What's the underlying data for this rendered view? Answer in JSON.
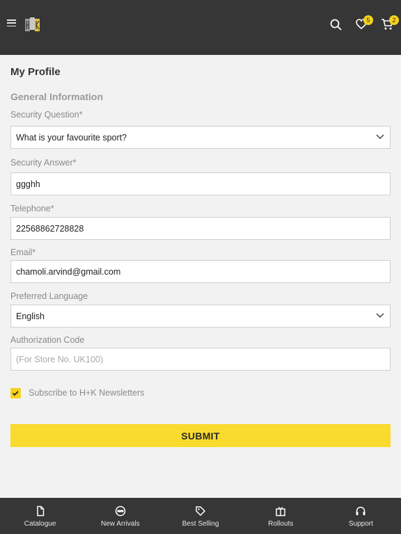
{
  "header": {
    "wishlist_count": "5",
    "cart_count": "2"
  },
  "profile": {
    "title": "My Profile",
    "section_title": "General Information",
    "security_question": {
      "label": "Security Question*",
      "value": "What is your favourite sport?"
    },
    "security_answer": {
      "label": "Security Answer*",
      "value": "ggghh"
    },
    "telephone": {
      "label": "Telephone*",
      "value": "22568862728828"
    },
    "email": {
      "label": "Email*",
      "value": "chamoli.arvind@gmail.com"
    },
    "preferred_language": {
      "label": "Preferred Language",
      "value": "English"
    },
    "authorization_code": {
      "label": "Authorization Code",
      "placeholder": "(For Store No. UK100)"
    },
    "newsletter": {
      "label": "Subscribe to H+K Newsletters",
      "checked": true
    },
    "submit_label": "SUBMIT"
  },
  "bottom_nav": {
    "items": [
      {
        "label": "Catalogue",
        "icon": "document-icon"
      },
      {
        "label": "New Arrivals",
        "icon": "new-badge-icon"
      },
      {
        "label": "Best Selling",
        "icon": "tag-icon"
      },
      {
        "label": "Rollouts",
        "icon": "box-icon"
      },
      {
        "label": "Support",
        "icon": "headset-icon"
      }
    ]
  },
  "colors": {
    "header_bg": "#363636",
    "accent": "#f8db2d",
    "page_bg": "#f2f2f2"
  }
}
